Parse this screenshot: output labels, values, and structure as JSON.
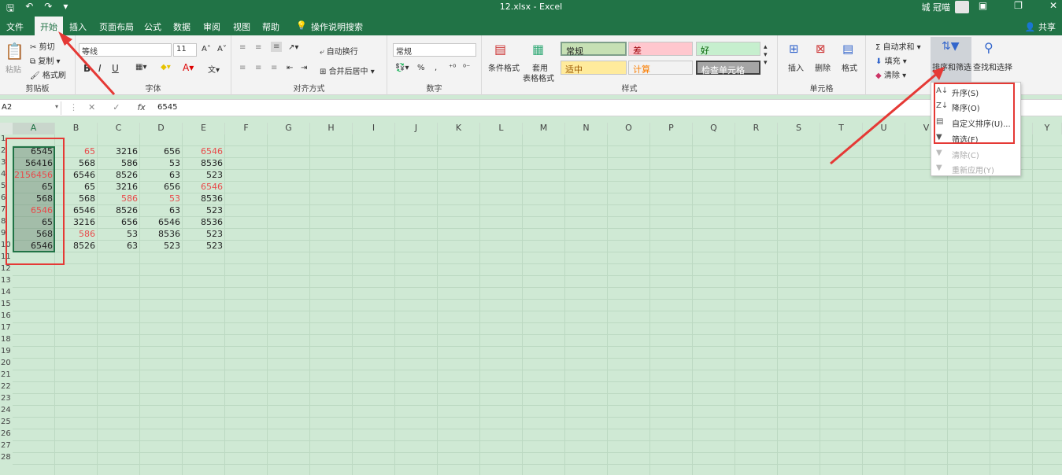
{
  "window": {
    "title": "12.xlsx  -  Excel",
    "user": "城 冠喵",
    "share": "共享"
  },
  "tabs": [
    "文件",
    "开始",
    "插入",
    "页面布局",
    "公式",
    "数据",
    "审阅",
    "视图",
    "帮助",
    "操作说明搜索"
  ],
  "active_tab": "开始",
  "ribbon": {
    "clipboard": {
      "label": "剪贴板",
      "paste": "粘贴",
      "cut": "剪切",
      "copy": "复制",
      "format_painter": "格式刷"
    },
    "font": {
      "label": "字体",
      "name": "等线",
      "size": "11",
      "bold": "B",
      "italic": "I",
      "underline": "U"
    },
    "alignment": {
      "label": "对齐方式",
      "wrap": "自动换行",
      "merge": "合并后居中"
    },
    "number": {
      "label": "数字",
      "format": "常规",
      "percent": "%",
      "comma": ","
    },
    "styles": {
      "label": "样式",
      "cond_format": "条件格式",
      "table_format_1": "套用",
      "table_format_2": "表格格式",
      "normal": "常规",
      "bad": "差",
      "good": "好",
      "neutral": "适中",
      "calc": "计算",
      "check": "检查单元格"
    },
    "cells": {
      "label": "单元格",
      "insert": "插入",
      "delete": "删除",
      "format": "格式"
    },
    "editing": {
      "autosum": "自动求和",
      "fill": "填充",
      "clear": "清除",
      "sort_filter": "排序和筛选",
      "find_select": "查找和选择"
    }
  },
  "formula_bar": {
    "name_box": "A2",
    "fx": "fx",
    "value": "6545"
  },
  "columns": [
    "A",
    "B",
    "C",
    "D",
    "E",
    "F",
    "G",
    "H",
    "I",
    "J",
    "K",
    "L",
    "M",
    "N",
    "O",
    "P",
    "Q",
    "R",
    "S",
    "T",
    "U",
    "V",
    "W",
    "X",
    "Y"
  ],
  "rows": [
    "1",
    "2",
    "3",
    "4",
    "5",
    "6",
    "7",
    "8",
    "9",
    "10",
    "11",
    "12",
    "13",
    "14",
    "15",
    "16",
    "17",
    "18",
    "19",
    "20",
    "21",
    "22",
    "23",
    "24",
    "25",
    "26",
    "27",
    "28",
    "29"
  ],
  "data": [
    [
      "6545",
      "65",
      "3216",
      "656",
      "6546"
    ],
    [
      "56416",
      "568",
      "586",
      "53",
      "8536"
    ],
    [
      "2156456",
      "6546",
      "8526",
      "63",
      "523"
    ],
    [
      "65",
      "65",
      "3216",
      "656",
      "6546"
    ],
    [
      "568",
      "568",
      "586",
      "53",
      "8536"
    ],
    [
      "6546",
      "6546",
      "8526",
      "63",
      "523"
    ],
    [
      "65",
      "3216",
      "656",
      "6546",
      "8536"
    ],
    [
      "568",
      "586",
      "53",
      "8536",
      "523"
    ],
    [
      "6546",
      "8526",
      "63",
      "523",
      "523"
    ]
  ],
  "red_cells": [
    [
      0,
      1
    ],
    [
      0,
      4
    ],
    [
      2,
      0
    ],
    [
      3,
      4
    ],
    [
      4,
      2
    ],
    [
      4,
      3
    ],
    [
      5,
      0
    ],
    [
      7,
      1
    ]
  ],
  "sort_menu": [
    {
      "label": "升序(S)",
      "enabled": true
    },
    {
      "label": "降序(O)",
      "enabled": true
    },
    {
      "label": "自定义排序(U)...",
      "enabled": true
    },
    {
      "label": "筛选(F)",
      "enabled": true
    },
    {
      "label": "清除(C)",
      "enabled": false
    },
    {
      "label": "重新应用(Y)",
      "enabled": false
    }
  ],
  "colors": {
    "accent": "#217346",
    "annotation": "#e53935",
    "grid_bg": "#cfe9d4"
  }
}
